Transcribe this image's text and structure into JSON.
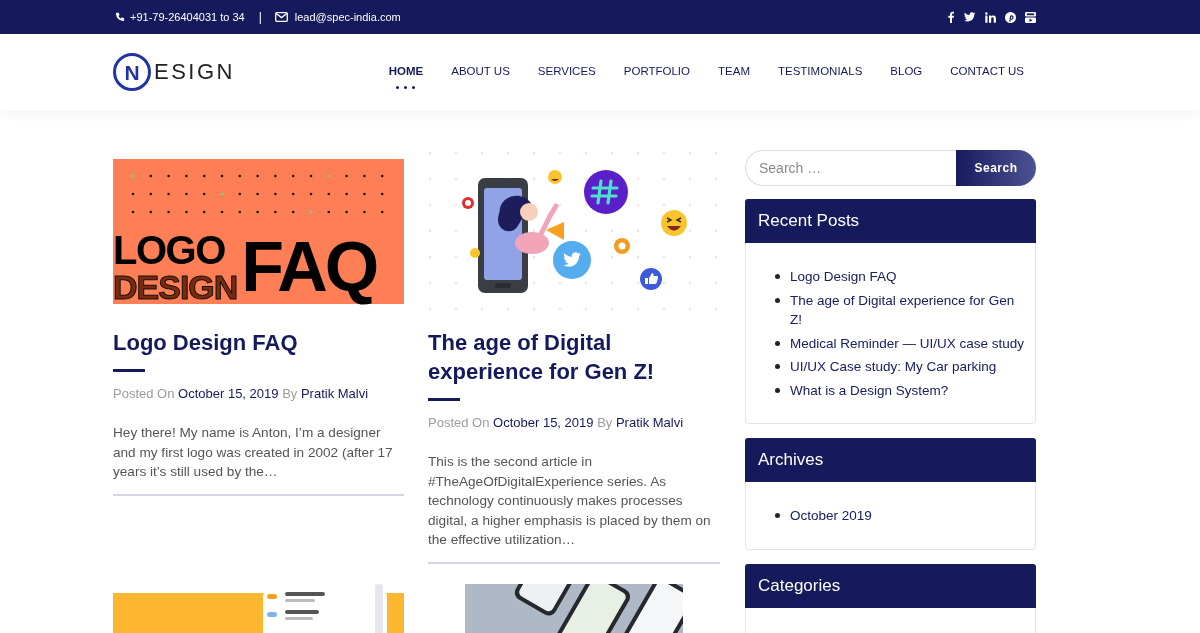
{
  "top_bar": {
    "phone": "+91-79-26404031 to 34",
    "separator": "|",
    "email": "lead@spec-india.com",
    "social": [
      {
        "kind": "facebook"
      },
      {
        "kind": "twitter"
      },
      {
        "kind": "linkedin"
      },
      {
        "kind": "pinterest"
      },
      {
        "kind": "youtube"
      }
    ]
  },
  "header": {
    "logo": {
      "mark": "N",
      "text": "ESIGN"
    },
    "nav": [
      {
        "label": "HOME",
        "selected": true
      },
      {
        "label": "ABOUT US",
        "selected": false
      },
      {
        "label": "SERVICES",
        "selected": false
      },
      {
        "label": "PORTFOLIO",
        "selected": false
      },
      {
        "label": "TEAM",
        "selected": false
      },
      {
        "label": "TESTIMONIALS",
        "selected": false
      },
      {
        "label": "BLOG",
        "selected": false
      },
      {
        "label": "CONTACT US",
        "selected": false
      }
    ]
  },
  "posts": [
    {
      "thumbnail": {
        "kind": "logo-graphic",
        "words": [
          "LOGO",
          "DESIGN",
          "FAQ"
        ]
      },
      "title": "Logo Design FAQ",
      "meta": {
        "posted_on": "Posted On",
        "date": "October 15, 2019",
        "by": "By",
        "author": "Pratik Malvi"
      },
      "excerpt": "Hey there! My name is Anton, I’m a designer and my first logo was created in 2002 (after 17 years it’s still used by the…"
    },
    {
      "thumbnail": {
        "kind": "social-illustration"
      },
      "title": "The age of Digital experience for Gen Z!",
      "meta": {
        "posted_on": "Posted On",
        "date": "October 15, 2019",
        "by": "By",
        "author": "Pratik Malvi"
      },
      "excerpt": "This is the second article in #TheAgeOfDigitalExperience series. As technology continuously makes processes digital, a higher emphasis is placed by them on the effective utilization…"
    },
    {
      "thumbnail": {
        "kind": "app-mockup"
      }
    },
    {
      "thumbnail": {
        "kind": "phones-photo"
      }
    }
  ],
  "sidebar": {
    "search": {
      "placeholder": "Search …",
      "button": "Search"
    },
    "widgets": [
      {
        "title": "Recent Posts",
        "items": [
          "Logo Design FAQ",
          "The age of Digital experience for Gen Z!",
          "Medical Reminder — UI/UX case study",
          "UI/UX Case study: My Car parking",
          "What is a Design System?"
        ]
      },
      {
        "title": "Archives",
        "items": [
          "October 2019"
        ]
      },
      {
        "title": "Categories"
      }
    ]
  }
}
